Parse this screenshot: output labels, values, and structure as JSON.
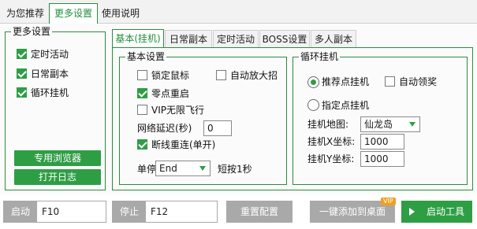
{
  "top_tabs": [
    "为您推荐",
    "更多设置",
    "使用说明"
  ],
  "left_panel": {
    "title": "更多设置",
    "items": [
      {
        "label": "定时活动",
        "checked": true
      },
      {
        "label": "日常副本",
        "checked": true
      },
      {
        "label": "循环挂机",
        "checked": true
      }
    ],
    "buttons": [
      "专用浏览器",
      "打开日志"
    ]
  },
  "inner_tabs": [
    "基本(挂机)",
    "日常副本",
    "定时活动",
    "BOSS设置",
    "多人副本"
  ],
  "basic": {
    "title": "基本设置",
    "lock_mouse": {
      "label": "锁定鼠标",
      "checked": false
    },
    "auto_ult": {
      "label": "自动放大招",
      "checked": false
    },
    "zero_hp_restart": {
      "label": "零点重启",
      "checked": true
    },
    "vip_fly": {
      "label": "VIP无限飞行",
      "checked": false
    },
    "net_delay_label": "网络延迟(秒)",
    "net_delay_value": "0",
    "reconnect": {
      "label": "断线重连(单开)",
      "checked": true
    },
    "single_stop_label": "单停",
    "single_stop_value": "End",
    "short_press": "短按1秒"
  },
  "loop": {
    "title": "循环挂机",
    "recommend": {
      "label": "推荐点挂机",
      "selected": true
    },
    "auto_reward": {
      "label": "自动领奖",
      "checked": false
    },
    "specified": {
      "label": "指定点挂机",
      "selected": false
    },
    "map_label": "挂机地图:",
    "map_value": "仙龙岛",
    "x_label": "挂机X坐标:",
    "x_value": "1000",
    "y_label": "挂机Y坐标:",
    "y_value": "1000"
  },
  "bottom": {
    "start_label": "启动",
    "start_key": "F10",
    "stop_label": "停止",
    "stop_key": "F12",
    "reset": "重置配置",
    "add_desktop": "一键添加到桌面",
    "vip_badge": "VIP",
    "launch": "启动工具"
  },
  "colors": {
    "accent": "#2e9e45",
    "border": "#2e8b3f",
    "disabled": "#a9a9a9",
    "vip": "#f0a020"
  }
}
